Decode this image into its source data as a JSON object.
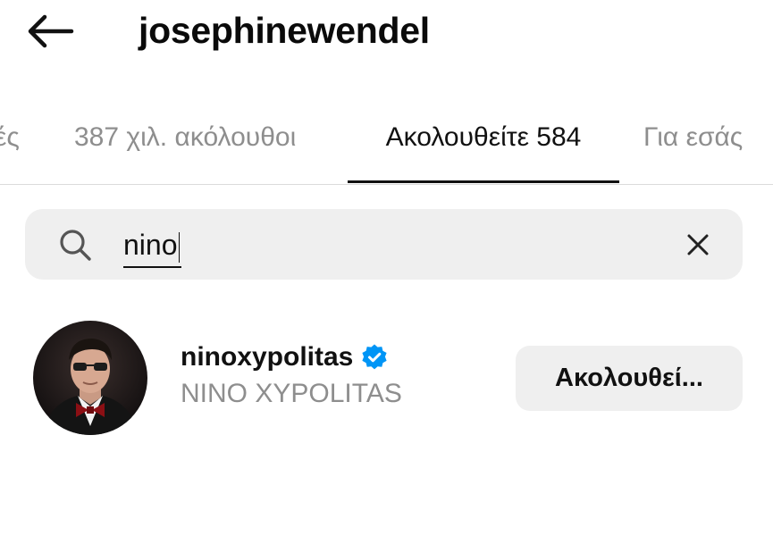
{
  "header": {
    "back_icon": "arrow-left-icon",
    "username": "josephinewendel"
  },
  "tabs": [
    {
      "label": "ές",
      "active": false
    },
    {
      "label": "387 χιλ. ακόλουθοι",
      "active": false
    },
    {
      "label": "Ακολουθείτε 584",
      "active": true
    },
    {
      "label": "Για εσάς",
      "active": false
    }
  ],
  "search": {
    "icon": "search-icon",
    "value": "nino",
    "clear_icon": "close-icon"
  },
  "results": [
    {
      "username": "ninoxypolitas",
      "verified": true,
      "full_name": "NINO XYPOLITAS",
      "button_label": "Ακολουθεί..."
    }
  ],
  "colors": {
    "text_primary": "#111111",
    "text_secondary": "#8e8e8e",
    "surface": "#efefef",
    "verified_blue": "#0095f6",
    "divider": "#dbdbdb"
  }
}
